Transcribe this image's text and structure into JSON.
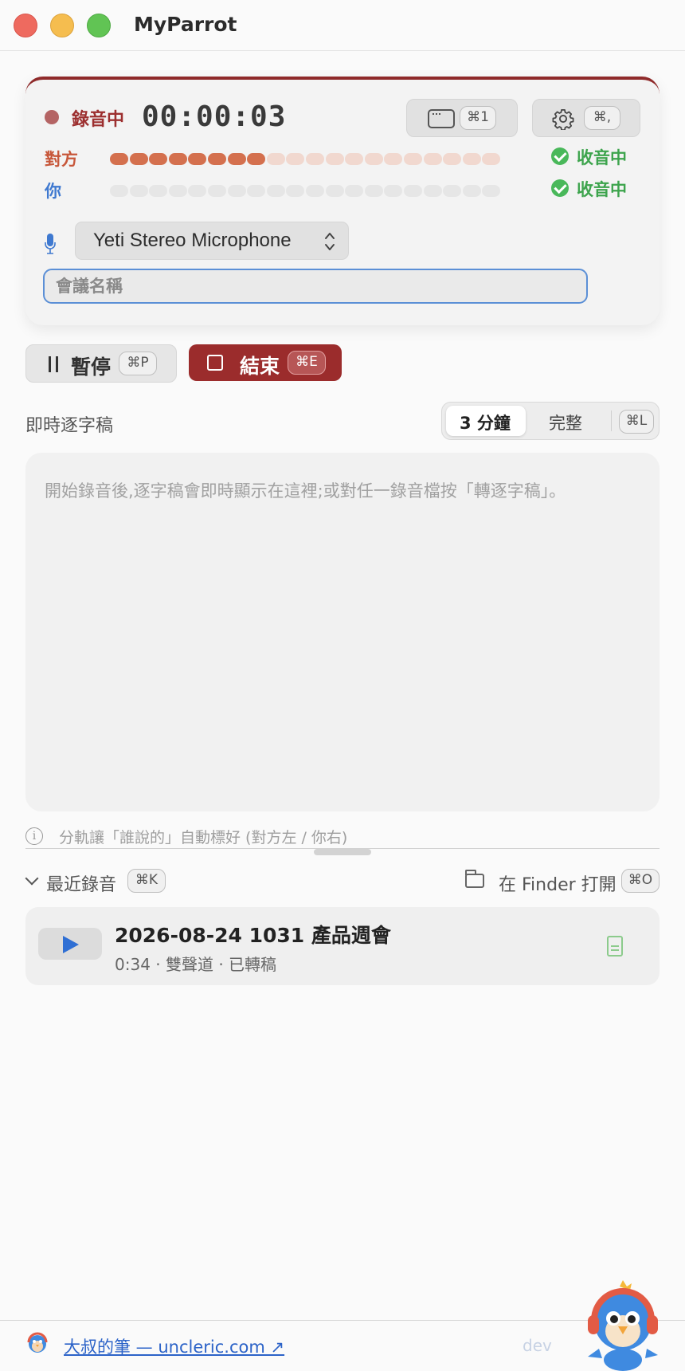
{
  "window": {
    "title": "MyParrot"
  },
  "recording": {
    "status_label": "錄音中",
    "timer": "00:00:03",
    "window_shortcut": "⌘1",
    "settings_shortcut": "⌘,",
    "other_label": "對方",
    "you_label": "你",
    "other_status": "收音中",
    "you_status": "收音中",
    "other_level_active_segments": 8,
    "total_segments": 20,
    "you_level_active_segments": 0,
    "mic_device": "Yeti Stereo Microphone",
    "meeting_name_placeholder": "會議名稱",
    "meeting_name_value": ""
  },
  "controls": {
    "pause_label": "暫停",
    "pause_shortcut": "⌘P",
    "stop_label": "結束",
    "stop_shortcut": "⌘E"
  },
  "transcript": {
    "title": "即時逐字稿",
    "view_options": [
      "3 分鐘",
      "完整"
    ],
    "selected_view": "3 分鐘",
    "toggle_shortcut": "⌘L",
    "placeholder": "開始錄音後,逐字稿會即時顯示在這裡;或對任一錄音檔按「轉逐字稿」。",
    "hint": "分軌讓「誰說的」自動標好 (對方左 / 你右)"
  },
  "recent": {
    "title": "最近錄音",
    "toggle_shortcut": "⌘K",
    "open_finder_label": "在 Finder 打開",
    "open_finder_shortcut": "⌘O",
    "items": [
      {
        "title": "2026-08-24 1031 產品週會",
        "meta": "0:34 · 雙聲道 · 已轉稿"
      }
    ]
  },
  "footer": {
    "link_text": "大叔的筆 — uncleric.com ↗",
    "build_label": "dev"
  },
  "colors": {
    "accent_red": "#9b2c2c",
    "other_meter_active": "#d4704e",
    "other_meter_inactive": "#f1d8cf",
    "you_meter_inactive": "#e6e6e6",
    "status_green": "#3da44d",
    "link_blue": "#2c63c8"
  },
  "icons": {
    "window_button": "window-icon",
    "settings_button": "gear-icon",
    "mic": "microphone-icon",
    "play": "play-icon",
    "transcript_file": "document-icon",
    "folder": "folder-icon",
    "info": "info-icon"
  }
}
